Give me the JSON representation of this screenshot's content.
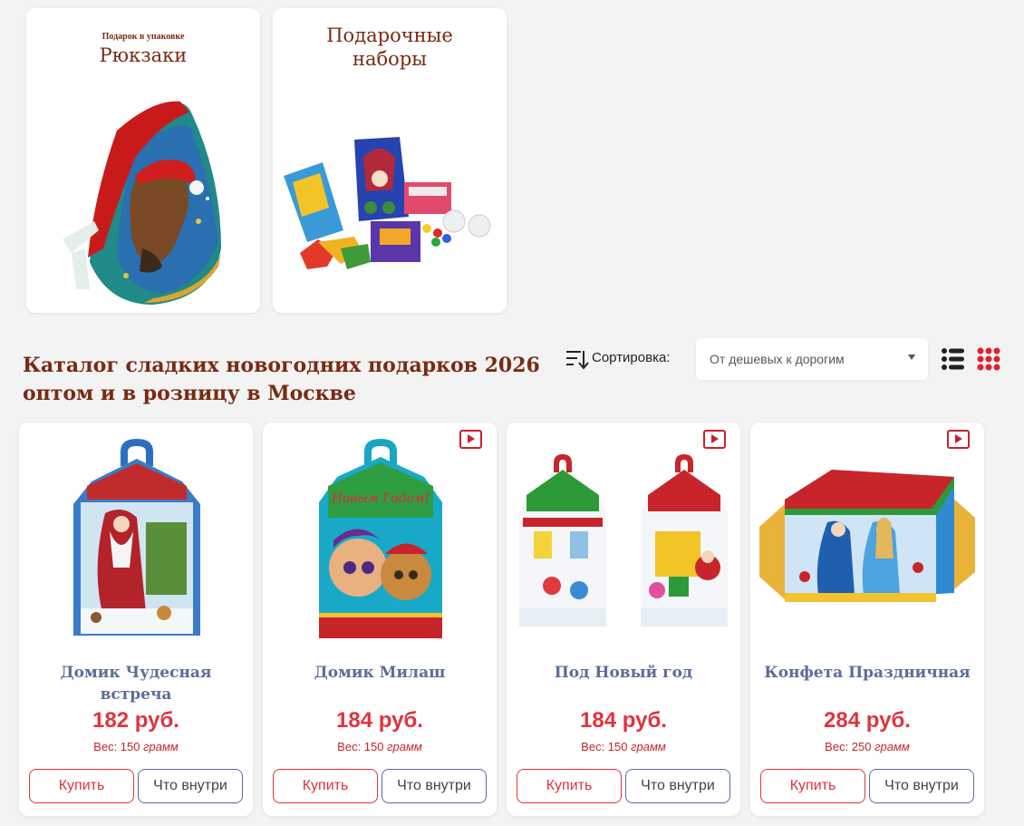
{
  "categories": [
    {
      "small_label": "Подарок в упаковке",
      "title": "Рюкзаки"
    },
    {
      "title": "Подарочные наборы"
    }
  ],
  "catalog_title": "Каталог сладких новогодних подарков 2026 оптом и в розницу в Москве",
  "sort": {
    "label": "Сортировка:",
    "selected": "От дешевых к дорогим"
  },
  "view": {
    "list_icon": "list-view-icon",
    "grid_icon": "grid-view-icon",
    "accent": "#e0222c"
  },
  "products": [
    {
      "name": "Домик Чудесная встреча",
      "price": "182 руб.",
      "weight_prefix": "Вес: 150",
      "weight_unit": "грамм",
      "buy": "Купить",
      "inside": "Что внутри",
      "has_video": false
    },
    {
      "name": "Домик Милаш",
      "price": "184 руб.",
      "weight_prefix": "Вес: 150",
      "weight_unit": "грамм",
      "buy": "Купить",
      "inside": "Что внутри",
      "has_video": true
    },
    {
      "name": "Под Новый год",
      "price": "184 руб.",
      "weight_prefix": "Вес: 150",
      "weight_unit": "грамм",
      "buy": "Купить",
      "inside": "Что внутри",
      "has_video": true
    },
    {
      "name": "Конфета Праздничная",
      "price": "284 руб.",
      "weight_prefix": "Вес: 250",
      "weight_unit": "грамм",
      "buy": "Купить",
      "inside": "Что внутри",
      "has_video": true
    }
  ],
  "colors": {
    "title_brown": "#7a2a13",
    "price_red": "#e0333f",
    "name_blue": "#5a6d99"
  }
}
